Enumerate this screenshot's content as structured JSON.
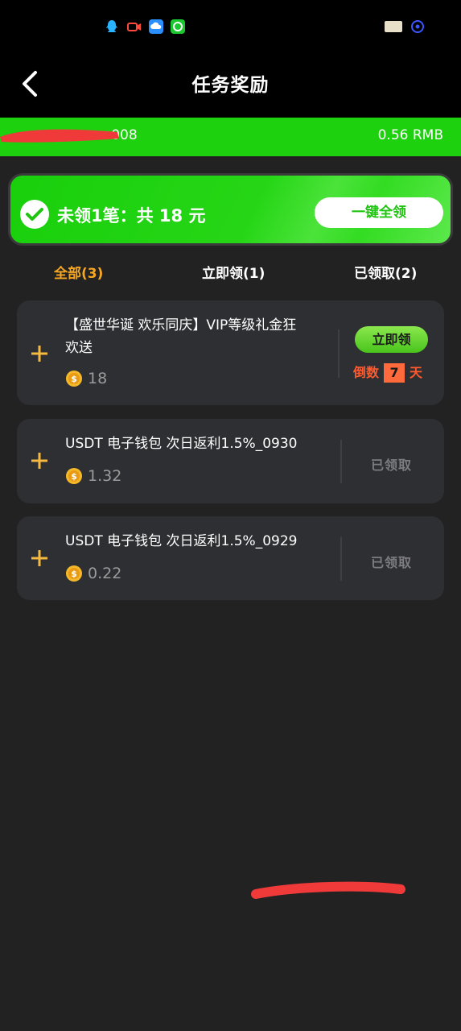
{
  "header": {
    "title": "任务奖励"
  },
  "account": {
    "id_suffix": "~008",
    "balance": "0.56 RMB"
  },
  "summary": {
    "text": "未领1笔：共 18 元",
    "claim_all_label": "一键全领"
  },
  "tabs": [
    {
      "label": "全部(3)",
      "active": true
    },
    {
      "label": "立即领(1)",
      "active": false
    },
    {
      "label": "已领取(2)",
      "active": false
    }
  ],
  "tasks": [
    {
      "title_line1": "【盛世华诞 欢乐同庆】VIP等级礼金狂",
      "title_line2": "欢送",
      "amount": "18",
      "action_label": "立即领",
      "countdown_prefix": "倒数",
      "countdown_days": "7",
      "countdown_suffix": "天"
    },
    {
      "title_line1": "USDT 电子钱包 次日返利1.5%_0930",
      "amount": "1.32",
      "status": "已领取"
    },
    {
      "title_line1": "USDT 电子钱包 次日返利1.5%_0929",
      "amount": "0.22",
      "status": "已领取"
    }
  ],
  "colors": {
    "accent_green": "#1ed10f",
    "tab_active": "#f5a623",
    "countdown": "#ff5a2e",
    "card_bg": "#2e2f33"
  },
  "icons": [
    "back-chevron-icon",
    "check-circle-icon",
    "plus-icon",
    "coin-icon"
  ]
}
